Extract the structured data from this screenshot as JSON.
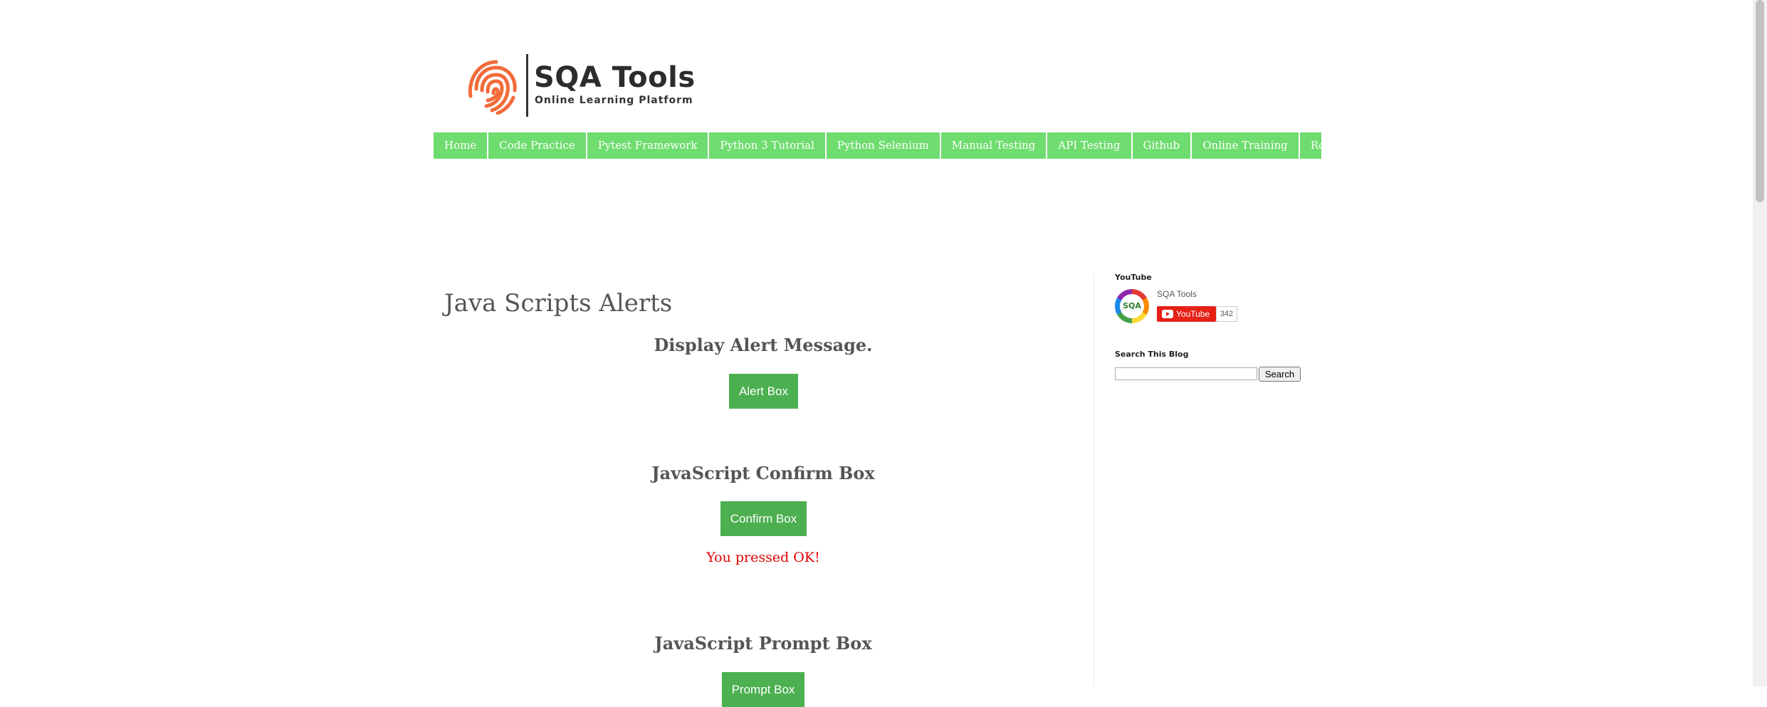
{
  "logo": {
    "title": "SQA Tools",
    "subtitle": "Online Learning Platform",
    "brand_color": "#f26b3a"
  },
  "nav": {
    "items": [
      {
        "label": "Home"
      },
      {
        "label": "Code Practice"
      },
      {
        "label": "Pytest Framework"
      },
      {
        "label": "Python 3 Tutorial"
      },
      {
        "label": "Python Selenium"
      },
      {
        "label": "Manual Testing"
      },
      {
        "label": "API Testing"
      },
      {
        "label": "Github"
      },
      {
        "label": "Online Training"
      },
      {
        "label": "Robot Framework"
      }
    ],
    "color": "#6fdc6f"
  },
  "main": {
    "title": "Java Scripts Alerts",
    "sections": [
      {
        "heading": "Display Alert Message.",
        "button_label": "Alert Box"
      },
      {
        "heading": "JavaScript Confirm Box",
        "button_label": "Confirm Box",
        "result": "You pressed OK!"
      },
      {
        "heading": "JavaScript Prompt Box",
        "button_label": "Prompt Box"
      }
    ],
    "button_color": "#4caf50",
    "result_color": "#e00000"
  },
  "sidebar": {
    "youtube": {
      "widget_title": "YouTube",
      "channel_name": "SQA Tools",
      "avatar_text": "SQA",
      "button_label": "YouTube",
      "subscriber_count": "342"
    },
    "search": {
      "widget_title": "Search This Blog",
      "input_value": "",
      "button_label": "Search"
    }
  }
}
